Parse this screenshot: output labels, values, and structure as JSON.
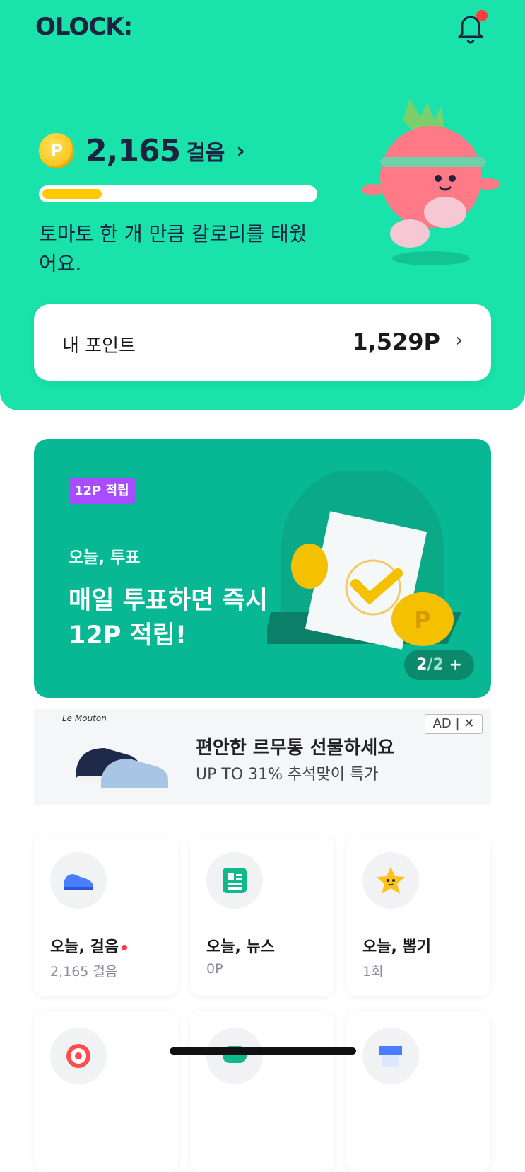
{
  "app": {
    "logo": "OLOCK:"
  },
  "header": {
    "bell_icon": "bell-icon",
    "has_notification": true
  },
  "steps": {
    "count": "2,165",
    "unit": "걸음",
    "progress": 0.22
  },
  "message": "토마토 한 개 만큼 칼로리를 태웠어요.",
  "points": {
    "label": "내 포인트",
    "value": "1,529P"
  },
  "banner": {
    "badge": "12P 적립",
    "subtitle": "오늘, 투표",
    "title": "매일 투표하면 즉시 12P 적립!",
    "pager": {
      "current": "2",
      "separator": "/",
      "total": "2",
      "more": "+"
    }
  },
  "ad": {
    "brand": "Le Mouton",
    "title": "편안한 르무통 선물하세요",
    "subtitle": "UP TO 31% 추석맞이 특가",
    "tag": "AD | ✕"
  },
  "tiles": [
    {
      "title": "오늘, 걸음",
      "sub": "2,165 걸음",
      "icon": "sneaker-icon",
      "dot": true
    },
    {
      "title": "오늘, 뉴스",
      "sub": "0P",
      "icon": "news-icon",
      "dot": false
    },
    {
      "title": "오늘, 뽑기",
      "sub": "1회",
      "icon": "star-icon",
      "dot": false
    }
  ],
  "tiles_row2": [
    {
      "icon": "target-icon"
    },
    {
      "icon": "chat-icon"
    },
    {
      "icon": "store-icon"
    }
  ],
  "colors": {
    "primary": "#19e2aa",
    "banner": "#08b894",
    "badge": "#a74dff",
    "accent": "#ffc800"
  }
}
